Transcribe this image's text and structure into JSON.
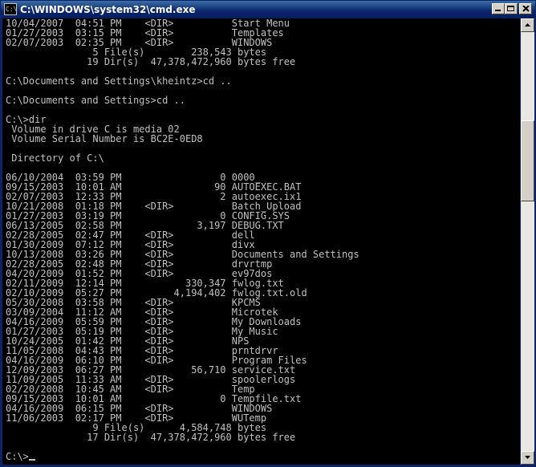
{
  "window": {
    "title": "C:\\WINDOWS\\system32\\cmd.exe",
    "icon": "cmd-icon",
    "icon_glyph": "C:\\"
  },
  "console": {
    "lines": [
      "10/04/2007  04:51 PM    <DIR>          Start Menu",
      "01/27/2003  03:15 PM    <DIR>          Templates",
      "02/07/2003  02:35 PM    <DIR>          WINDOWS",
      "               5 File(s)        238,543 bytes",
      "              19 Dir(s)  47,378,472,960 bytes free",
      "",
      "C:\\Documents and Settings\\kheintz>cd ..",
      "",
      "C:\\Documents and Settings>cd ..",
      "",
      "C:\\>dir",
      " Volume in drive C is media 02",
      " Volume Serial Number is BC2E-0ED8",
      "",
      " Directory of C:\\",
      "",
      "06/10/2004  03:59 PM                 0 0000_",
      "09/15/2003  10:01 AM                90 AUTOEXEC.BAT",
      "02/07/2003  12:33 PM                 2 autoexec.ix1",
      "10/21/2008  01:18 PM    <DIR>          Batch_Upload",
      "01/27/2003  03:19 PM                 0 CONFIG.SYS",
      "06/13/2005  02:58 PM             3,197 DEBUG.TXT",
      "02/28/2005  02:47 PM    <DIR>          dell",
      "01/30/2009  07:12 PM    <DIR>          divx",
      "10/13/2008  03:26 PM    <DIR>          Documents and Settings",
      "02/28/2005  02:48 PM    <DIR>          drvrtmp",
      "04/20/2009  01:52 PM    <DIR>          ev97dos",
      "02/11/2009  12:14 PM           330,347 fwlog.txt",
      "02/10/2009  05:27 PM         4,194,402 fwlog.txt.old",
      "05/30/2008  03:58 PM    <DIR>          KPCMS",
      "03/09/2004  11:12 AM    <DIR>          Microtek",
      "04/16/2009  05:59 PM    <DIR>          My Downloads",
      "01/27/2003  05:19 PM    <DIR>          My Music",
      "10/24/2005  01:42 PM    <DIR>          NPS",
      "11/05/2008  04:43 PM    <DIR>          prntdrvr",
      "04/16/2009  06:10 PM    <DIR>          Program Files",
      "12/09/2003  06:27 PM            56,710 service.txt",
      "11/09/2005  11:33 AM    <DIR>          spoolerlogs",
      "02/20/2008  10:45 AM    <DIR>          Temp",
      "09/15/2003  10:01 AM                 0 Tempfile.txt",
      "04/16/2009  06:15 PM    <DIR>          WINDOWS",
      "11/06/2003  02:17 PM    <DIR>          WUTemp",
      "               9 File(s)      4,584,748 bytes",
      "              17 Dir(s)  47,378,472,960 bytes free",
      "",
      "C:\\>"
    ]
  },
  "colors": {
    "console_background": "#000000",
    "console_text": "#c0c0c0",
    "titlebar": "#0a246a"
  }
}
